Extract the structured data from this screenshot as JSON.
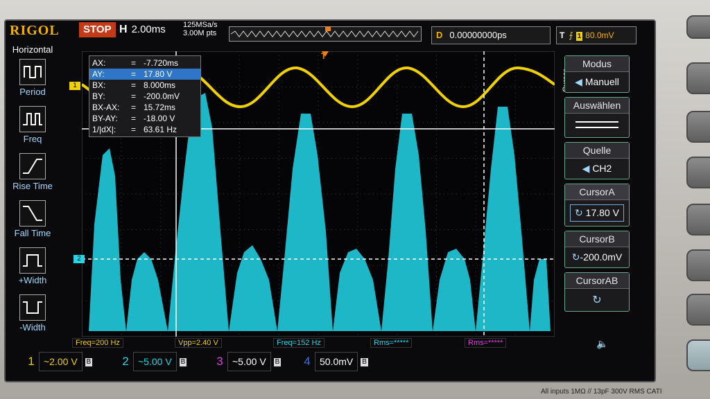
{
  "header": {
    "brand": "RIGOL",
    "run_state": "STOP",
    "timebase_label": "H",
    "timebase_value": "2.00ms",
    "sample_rate": "125MSa/s",
    "memory_depth": "3.00M pts",
    "trigger_pos_label": "D",
    "trigger_pos_value": "0.00000000ps",
    "trigger_label": "T",
    "trigger_channel": "1",
    "trigger_level": "80.0mV"
  },
  "left_menu": {
    "title": "Horizontal",
    "items": [
      {
        "label": "Period",
        "icon": "period-icon"
      },
      {
        "label": "Freq",
        "icon": "frequency-icon"
      },
      {
        "label": "Rise Time",
        "icon": "rise-time-icon"
      },
      {
        "label": "Fall Time",
        "icon": "fall-time-icon"
      },
      {
        "label": "+Width",
        "icon": "positive-width-icon"
      },
      {
        "label": "-Width",
        "icon": "negative-width-icon"
      }
    ]
  },
  "readout": {
    "rows": [
      {
        "key": "AX:",
        "eq": "=",
        "value": "-7.720ms"
      },
      {
        "key": "AY:",
        "eq": "=",
        "value": "17.80 V"
      },
      {
        "key": "BX:",
        "eq": "=",
        "value": "8.000ms"
      },
      {
        "key": "BY:",
        "eq": "=",
        "value": "-200.0mV"
      },
      {
        "key": "BX-AX:",
        "eq": "=",
        "value": "15.72ms"
      },
      {
        "key": "BY-AY:",
        "eq": "=",
        "value": "-18.00 V"
      },
      {
        "key": "1/|dX|:",
        "eq": "=",
        "value": "63.61 Hz"
      }
    ]
  },
  "right_menu": {
    "vertical_label": "Cursor",
    "mode_label": "Modus",
    "mode_value": "Manuell",
    "select_label": "Auswählen",
    "source_label": "Quelle",
    "source_value": "CH2",
    "cursor_a_label": "CursorA",
    "cursor_a_value": "17.80 V",
    "cursor_b_label": "CursorB",
    "cursor_b_value": "-200.0mV",
    "cursor_ab_label": "CursorAB"
  },
  "markers": {
    "ch1": "1",
    "ch2": "2",
    "trigger": "T"
  },
  "measurements": [
    {
      "text": "Freq=200 Hz",
      "color": "#f0d000"
    },
    {
      "text": "Vpp=2.40 V",
      "color": "#f0d000"
    },
    {
      "text": "Freq=152 Hz",
      "color": "#27d6e6"
    },
    {
      "text": "Rms=*****",
      "color": "#27d6e6"
    },
    {
      "text": "Rms=*****",
      "color": "#e040e0"
    }
  ],
  "channels": [
    {
      "num": "1",
      "value": "~2.00 V",
      "bw": "B",
      "color": "#f0d000"
    },
    {
      "num": "2",
      "value": "~5.00 V",
      "bw": "B",
      "color": "#27d6e6"
    },
    {
      "num": "3",
      "value": "~5.00 V",
      "bw": "B",
      "color": "#e040e0"
    },
    {
      "num": "4",
      "value": "50.0mV",
      "bw": "B",
      "color": "#3a70d8"
    }
  ],
  "footer": "All inputs 1MΩ // 13pF 300V RMS  CATI",
  "colors": {
    "ch1": "#f0d000",
    "ch2": "#27d6e6",
    "accent": "#2f76c8"
  }
}
